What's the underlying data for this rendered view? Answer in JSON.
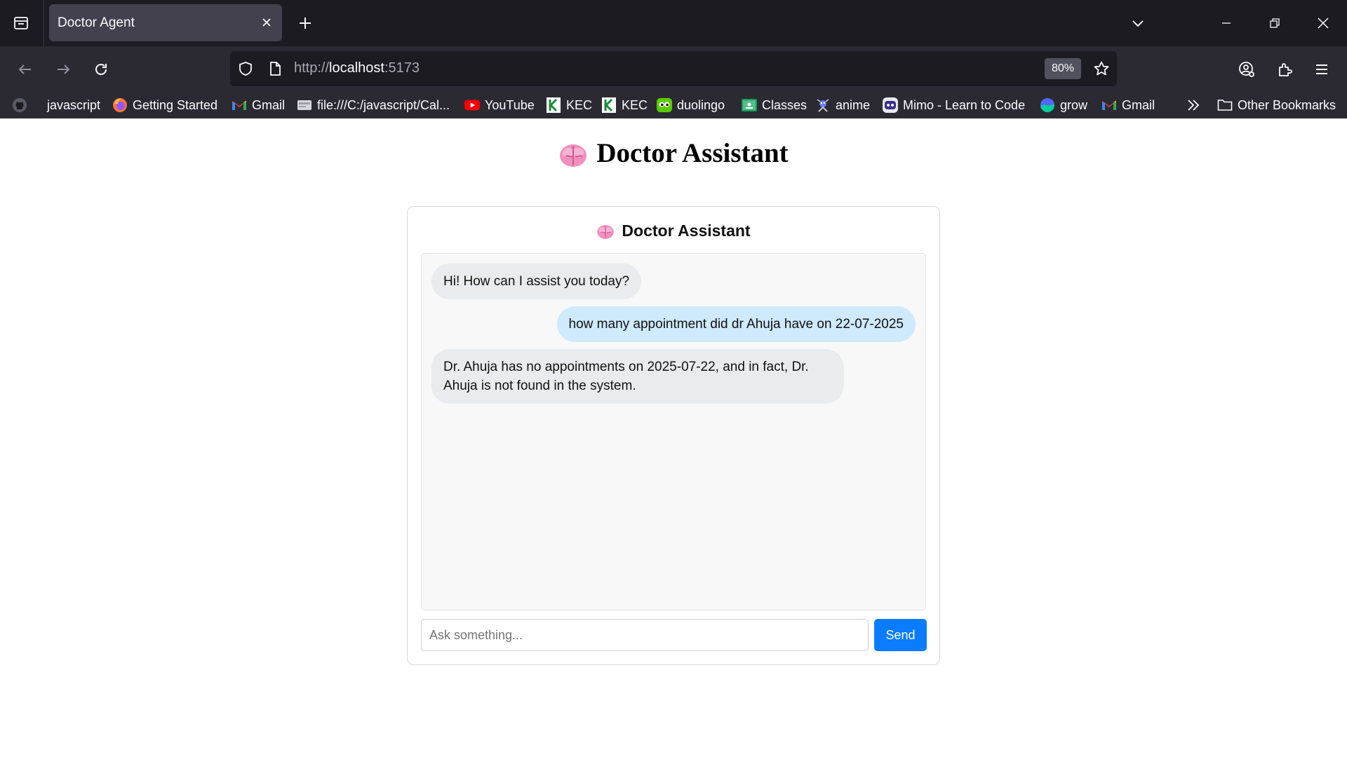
{
  "browser": {
    "tab": {
      "title": "Doctor Agent"
    },
    "url": {
      "scheme": "http://",
      "host": "localhost",
      "port": ":5173"
    },
    "zoom": "80%",
    "bookmarks": [
      {
        "label": "",
        "icon": "github-icon"
      },
      {
        "label": "javascript",
        "icon": ""
      },
      {
        "label": "Getting Started",
        "icon": "firefox-icon"
      },
      {
        "label": "Gmail",
        "icon": "gmail-icon"
      },
      {
        "label": "file:///C:/javascript/Cal...",
        "icon": "file-icon"
      },
      {
        "label": "YouTube",
        "icon": "youtube-icon"
      },
      {
        "label": "KEC",
        "icon": "kec-icon"
      },
      {
        "label": "KEC",
        "icon": "kec-icon"
      },
      {
        "label": "duolingo",
        "icon": "duolingo-icon"
      },
      {
        "label": "Classes",
        "icon": "classroom-icon"
      },
      {
        "label": "anime",
        "icon": "anime-icon"
      },
      {
        "label": "Mimo - Learn to Code",
        "icon": "mimo-icon"
      },
      {
        "label": "grow",
        "icon": "grow-icon"
      },
      {
        "label": "Gmail",
        "icon": "gmail-icon"
      }
    ],
    "other_bookmarks": "Other Bookmarks"
  },
  "page": {
    "title": "Doctor Assistant",
    "card_title": "Doctor Assistant",
    "messages": [
      {
        "role": "bot",
        "text": "Hi! How can I assist you today?"
      },
      {
        "role": "user",
        "text": "how many appointment did dr Ahuja have on 22-07-2025"
      },
      {
        "role": "bot",
        "text": "Dr. Ahuja has no appointments on 2025-07-22, and in fact, Dr. Ahuja is not found in the system."
      }
    ],
    "input": {
      "placeholder": "Ask something...",
      "value": ""
    },
    "send_label": "Send",
    "accent_color": "#0a7cff"
  }
}
